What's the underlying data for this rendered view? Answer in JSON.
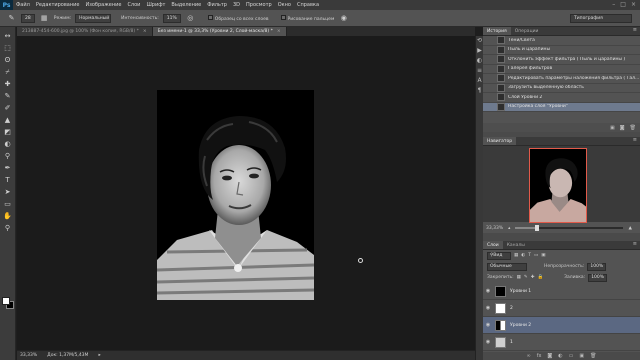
{
  "menubar": {
    "logo": "Ps",
    "items": [
      "Файл",
      "Редактирование",
      "Изображение",
      "Слои",
      "Шрифт",
      "Выделение",
      "Фильтр",
      "3D",
      "Просмотр",
      "Окно",
      "Справка"
    ],
    "window_controls": [
      "–",
      "□",
      "×"
    ]
  },
  "options": {
    "brush_size": "28",
    "mode_label": "Режим:",
    "mode_value": "Нормальный",
    "strength_label": "Интенсивность:",
    "strength_value": "11%",
    "sample_all_label": "Образец со всех слоев",
    "finger_label": "Рисование пальцем",
    "workspace": "Типография"
  },
  "tools": [
    "↔",
    "⬚",
    "ʘ",
    "⌿",
    "✚",
    "✎",
    "✐",
    "▲",
    "◩",
    "◐",
    "⚲",
    "✒",
    "T",
    "➤",
    "▭",
    "✋",
    "⚲"
  ],
  "tabs": [
    {
      "label": "213887-454-600.jpg @ 100% (Фон копия, RGB/8) *",
      "active": false
    },
    {
      "label": "Без имени-1 @ 33,3% (Уровни 2, Слой-маска/8) *",
      "active": true
    }
  ],
  "tab_close": "×",
  "status": {
    "zoom": "33,33%",
    "doc": "Док: 1,37M/5,43M"
  },
  "history": {
    "tabs": [
      "История",
      "Операции"
    ],
    "items": [
      {
        "label": "Тени/Света",
        "selected": false
      },
      {
        "label": "Пыль и царапины",
        "selected": false
      },
      {
        "label": "Отклонить эффект фильтра ( Пыль и царапины )",
        "selected": false
      },
      {
        "label": "Галерея фильтров",
        "selected": false
      },
      {
        "label": "Редактировать параметры наложения фильтра ( Гал...",
        "selected": false
      },
      {
        "label": "Загрузить выделенную область",
        "selected": false
      },
      {
        "label": "Слой Уровни 2",
        "selected": false
      },
      {
        "label": "Настройка слоя \"Уровни\"",
        "selected": true
      }
    ]
  },
  "navigator": {
    "tab": "Навигатор",
    "zoom": "33,33%",
    "zoom_fraction": 0.2
  },
  "layers": {
    "tabs": [
      "Слои",
      "Каналы"
    ],
    "kind": "Вид",
    "blend": "Обычные",
    "opacity_label": "Непрозрачность:",
    "opacity": "100%",
    "lock_label": "Закрепить:",
    "fill_label": "Заливка:",
    "fill": "100%",
    "rows": [
      {
        "name": "Уровни 1",
        "selected": false
      },
      {
        "name": "2",
        "selected": false
      },
      {
        "name": "Уровни 2",
        "selected": true
      },
      {
        "name": "1",
        "selected": false
      }
    ]
  },
  "colors": {
    "accent": "#e25a4a",
    "selection": "#6e7a8e"
  }
}
